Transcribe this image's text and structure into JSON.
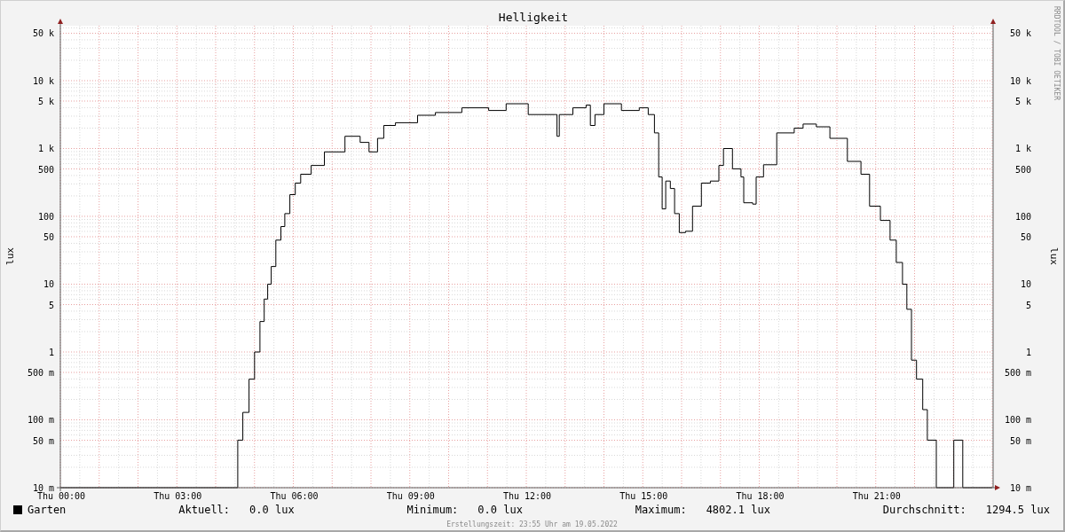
{
  "chart": {
    "title": "Helligkeit",
    "ylabel": "lux",
    "x_labels": [
      "Thu 00:00",
      "Thu 03:00",
      "Thu 06:00",
      "Thu 09:00",
      "Thu 12:00",
      "Thu 15:00",
      "Thu 18:00",
      "Thu 21:00"
    ],
    "y_labels": [
      "50 k",
      "10 k",
      "5 k",
      "1 k",
      "500",
      "100",
      "50",
      "10",
      "5",
      "1",
      "500 m",
      "100 m",
      "50 m",
      "10 m"
    ]
  },
  "right_axis": {
    "label": "lux",
    "ticks": [
      "50 k",
      "10 k",
      "5 k",
      "1 k",
      "500",
      "100",
      "50",
      "10",
      "5",
      "1",
      "500 m",
      "100 m",
      "50 m",
      "10 m"
    ]
  },
  "side_note": "RRDTOOL / TOBI OETIKER",
  "legend": {
    "series_name": "Garten",
    "color": "#000000",
    "stats": [
      {
        "label": "Aktuell:",
        "value": "0.0 lux"
      },
      {
        "label": "Minimum:",
        "value": "0.0 lux"
      },
      {
        "label": "Maximum:",
        "value": "4802.1 lux"
      },
      {
        "label": "Durchschnitt:",
        "value": "1294.5 lux"
      }
    ]
  },
  "footer": "Erstellungszeit: 23:55 Uhr am 19.05.2022"
}
